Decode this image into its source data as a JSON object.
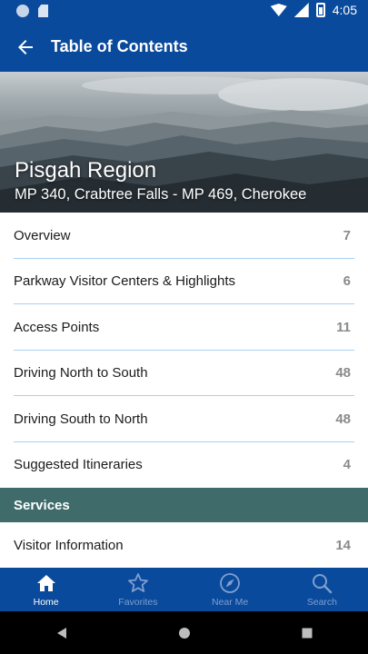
{
  "status_bar": {
    "time": "4:05"
  },
  "app_bar": {
    "title": "Table of Contents",
    "back_icon": "back-arrow-icon"
  },
  "hero": {
    "region_name": "Pisgah Region",
    "range": "MP 340, Crabtree Falls - MP 469, Cherokee"
  },
  "toc": {
    "items": [
      {
        "label": "Overview",
        "count": "7"
      },
      {
        "label": "Parkway Visitor Centers & Highlights",
        "count": "6"
      },
      {
        "label": "Access Points",
        "count": "11"
      },
      {
        "label": "Driving North to South",
        "count": "48"
      },
      {
        "label": "Driving South to North",
        "count": "48"
      },
      {
        "label": "Suggested Itineraries",
        "count": "4"
      }
    ],
    "services_header": "Services",
    "services_items": [
      {
        "label": "Visitor Information",
        "count": "14"
      }
    ]
  },
  "bottom_nav": {
    "items": [
      {
        "label": "Home",
        "icon": "home-icon",
        "active": true
      },
      {
        "label": "Favorites",
        "icon": "star-icon",
        "active": false
      },
      {
        "label": "Near Me",
        "icon": "navigation-icon",
        "active": false
      },
      {
        "label": "Search",
        "icon": "search-icon",
        "active": false
      }
    ]
  },
  "colors": {
    "primary": "#0a4a9c",
    "section_header": "#3f6b6a",
    "divider": "#a9d1ee",
    "count_text": "#8a8a8a",
    "nav_inactive": "#7f9fd0"
  }
}
